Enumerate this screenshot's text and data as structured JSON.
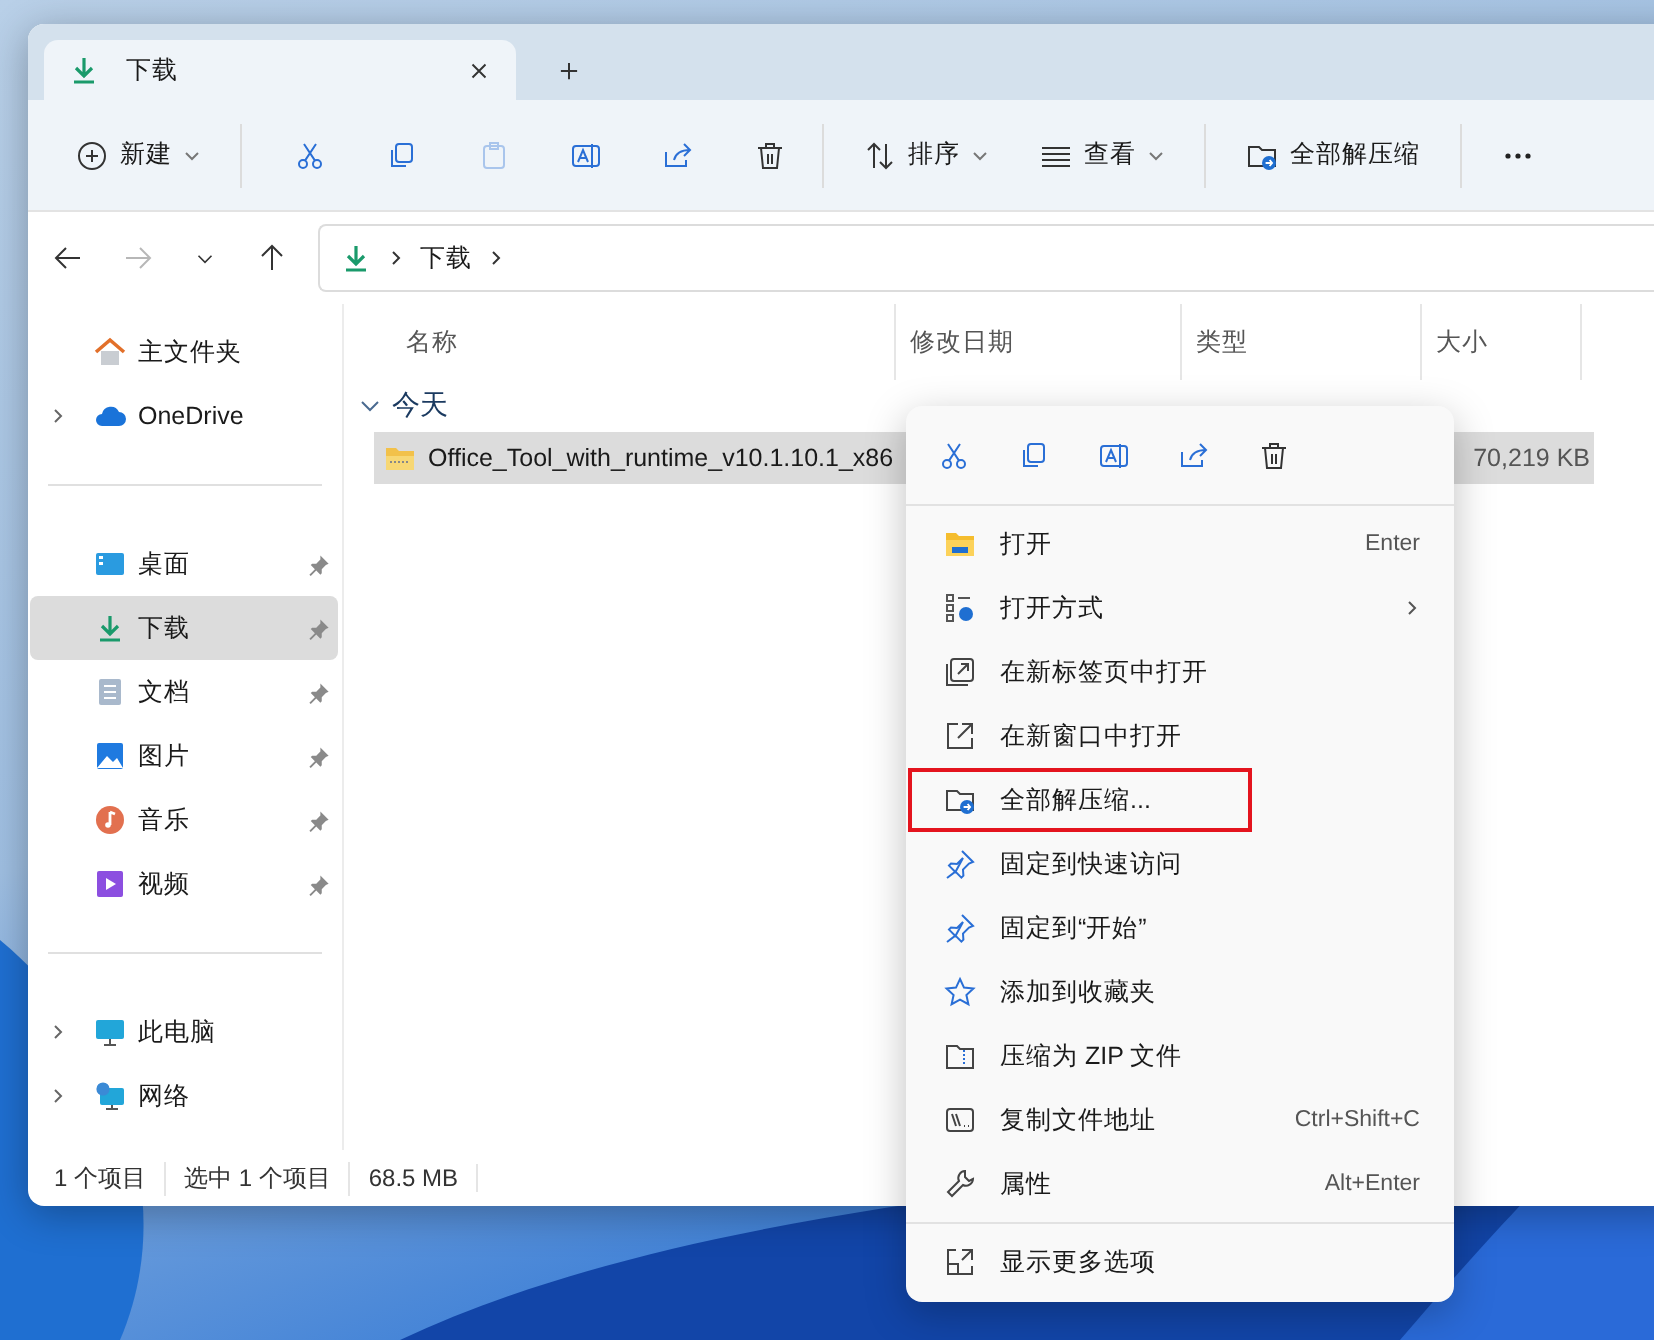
{
  "tab": {
    "title": "下载"
  },
  "toolbar": {
    "new_label": "新建",
    "icon_buttons": [
      {
        "disabled": false
      },
      {
        "disabled": false
      },
      {
        "disabled": true
      },
      {
        "disabled": false
      },
      {
        "disabled": false
      },
      {
        "disabled": false
      }
    ],
    "sort_label": "排序",
    "view_label": "查看",
    "extract_label": "全部解压缩"
  },
  "nav": {
    "back_disabled": false,
    "forward_disabled": true
  },
  "breadcrumb": [
    "下载"
  ],
  "sidebar": {
    "groups": [
      [
        {
          "kind": "home",
          "label": "主文件夹",
          "expandable": false,
          "pinned": false,
          "selected": false
        },
        {
          "kind": "cloud",
          "label": "OneDrive",
          "expandable": true,
          "pinned": false,
          "selected": false
        }
      ],
      [
        {
          "kind": "desktop",
          "label": "桌面",
          "expandable": false,
          "pinned": true,
          "selected": false
        },
        {
          "kind": "download",
          "label": "下载",
          "expandable": false,
          "pinned": true,
          "selected": true
        },
        {
          "kind": "document",
          "label": "文档",
          "expandable": false,
          "pinned": true,
          "selected": false
        },
        {
          "kind": "picture",
          "label": "图片",
          "expandable": false,
          "pinned": true,
          "selected": false
        },
        {
          "kind": "music",
          "label": "音乐",
          "expandable": false,
          "pinned": true,
          "selected": false
        },
        {
          "kind": "video",
          "label": "视频",
          "expandable": false,
          "pinned": true,
          "selected": false
        }
      ],
      [
        {
          "kind": "pc",
          "label": "此电脑",
          "expandable": true,
          "pinned": false,
          "selected": false
        },
        {
          "kind": "network",
          "label": "网络",
          "expandable": true,
          "pinned": false,
          "selected": false
        }
      ]
    ]
  },
  "table": {
    "columns": [
      "名称",
      "修改日期",
      "类型",
      "大小"
    ],
    "groups": [
      {
        "label": "今天",
        "expanded": true,
        "rows": [
          {
            "name": "Office_Tool_with_runtime_v10.1.10.1_x86",
            "size": "70,219 KB",
            "selected": true
          }
        ]
      }
    ]
  },
  "status_bar": [
    "1 个项目",
    "选中 1 个项目",
    "68.5 MB"
  ],
  "context_menu": {
    "items": [
      {
        "kind": "open",
        "label": "打开",
        "shortcut": "Enter",
        "submenu": false,
        "highlighted": false
      },
      {
        "kind": "open-with",
        "label": "打开方式",
        "submenu": true,
        "highlighted": false
      },
      {
        "kind": "new-tab",
        "label": "在新标签页中打开",
        "submenu": false,
        "highlighted": false
      },
      {
        "kind": "new-window",
        "label": "在新窗口中打开",
        "submenu": false,
        "highlighted": false
      },
      {
        "kind": "extract",
        "label": "全部解压缩...",
        "submenu": false,
        "highlighted": true
      },
      {
        "kind": "pin",
        "label": "固定到快速访问",
        "submenu": false,
        "highlighted": false
      },
      {
        "kind": "pin",
        "label": "固定到“开始”",
        "submenu": false,
        "highlighted": false
      },
      {
        "kind": "star",
        "label": "添加到收藏夹",
        "submenu": false,
        "highlighted": false
      },
      {
        "kind": "zip",
        "label": "压缩为 ZIP 文件",
        "submenu": false,
        "highlighted": false
      },
      {
        "kind": "copy-path",
        "label": "复制文件地址",
        "shortcut": "Ctrl+Shift+C",
        "submenu": false,
        "highlighted": false
      },
      {
        "kind": "properties",
        "label": "属性",
        "shortcut": "Alt+Enter",
        "submenu": false,
        "highlighted": false
      }
    ],
    "footer": {
      "kind": "more",
      "label": "显示更多选项"
    }
  }
}
